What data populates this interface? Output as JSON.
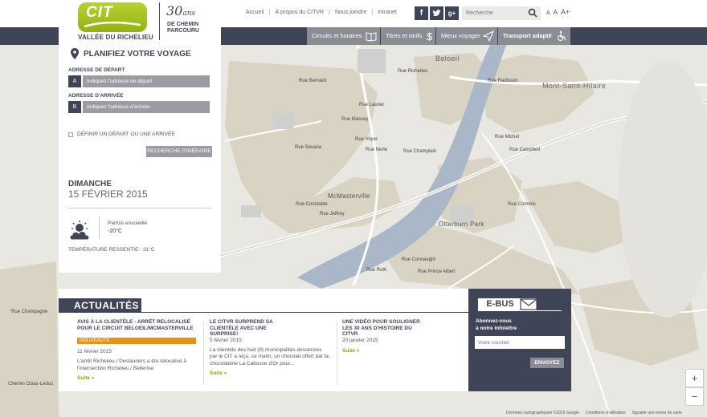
{
  "logo": {
    "brand": "CIT",
    "region": "VALLÉE DU RICHELIEU",
    "anniversary_number": "30",
    "anniversary_word": "ans",
    "anniversary_tag_1": "DE CHEMIN",
    "anniversary_tag_2": "PARCOURU"
  },
  "topnav": {
    "links": [
      "Accueil",
      "À propos du CITVR",
      "Nous joindre",
      "Intranet"
    ]
  },
  "social": [
    "f",
    "t",
    "g+"
  ],
  "search": {
    "placeholder": "Recherche"
  },
  "font_sizes": [
    "A",
    "A",
    "A+"
  ],
  "nav": {
    "items": [
      "Circuits et horaires",
      "Titres et tarifs",
      "Mieux voyager",
      "Transport adapté"
    ]
  },
  "planner": {
    "title": "PLANIFIEZ VOTRE VOYAGE",
    "departure_label": "ADRESSE DE DÉPART",
    "departure_key": "A",
    "departure_placeholder": "Indiquez l'adresse de départ",
    "arrival_label": "ADRESSE D'ARRIVÉE",
    "arrival_key": "B",
    "arrival_placeholder": "Indiquez l'adresse d'arrivée",
    "checkbox_label": "DÉFINIR UN DÉPART OU UNE ARRIVÉE",
    "search_button": "RECHERCHE ITINÉRAIRE"
  },
  "weather": {
    "day": "DIMANCHE",
    "date": "15 FÉVRIER 2015",
    "condition": "Parfois ensoleillé",
    "temperature": "-20°C",
    "feels_like": "TEMPÉRATURE RESSENTIE: -31°C"
  },
  "news": {
    "title": "ACTUALITÉS",
    "items": [
      {
        "headline": "AVIS À LA CLIENTÈLE - ARRÊT RELOCALISÉ POUR LE CIRCUIT BELOEIL/MCMASTERVILLE",
        "badge": "NOUVEAUTÉ",
        "date": "11 février 2015",
        "body": "L'arrêt Richelieu / Deslauriers a été relocalisé à l'intersection Richelieu / Bellerive.",
        "more": "Suite »"
      },
      {
        "headline": "LE CITVR SURPREND SA CLIENTÈLE AVEC UNE SURPRISE!",
        "badge": "",
        "date": "5 février 2015",
        "body": "La clientèle des huit (8) municipalités desservies par le CIT a reçu, ce matin, un chocolat offert par la chocolaterie La Cabosse d'Or pour...",
        "more": "Suite »"
      },
      {
        "headline": "UNE VIDÉO POUR SOULIGNER LES 30 ANS D'HISTOIRE DU CITVR",
        "badge": "",
        "date": "20 janvier 2015",
        "body": "",
        "more": "Suite »"
      }
    ]
  },
  "ebus": {
    "title": "E-BUS",
    "text_1": "Abonnez-vous",
    "text_2": "à notre infolettre",
    "placeholder": "Votre courriel",
    "button": "ENVOYEZ"
  },
  "map": {
    "cities": [
      "Beloeil",
      "Mont-Saint-Hilaire",
      "McMasterville",
      "Otterburn Park"
    ],
    "streets": [
      "Rue Bernard",
      "Rue Savaria",
      "Rue Laurier",
      "Rue Richelieu",
      "Rue Radisson",
      "Rue Massey",
      "Rue Voyer",
      "Rue Nerle",
      "Rue Champlain",
      "Rue Michel",
      "Rue Campbell",
      "Rue Comtois",
      "Rue Constable",
      "Rue Jeffrey",
      "Rue Prince Albert",
      "Rue Connaught",
      "Rue Ruth",
      "Chemin Ozias-Leduc",
      "Rue Champagne"
    ],
    "zoom_in": "+",
    "zoom_out": "−",
    "footer": [
      "Données cartographiques ©2015 Google",
      "Conditions d'utilisation",
      "Signaler une erreur de carte"
    ]
  },
  "colors": {
    "navy": "#3f4457",
    "accent_green": "#93b117",
    "badge_orange": "#e7911d",
    "river": "#a9b7c9",
    "residential": "#d9d3c4"
  }
}
